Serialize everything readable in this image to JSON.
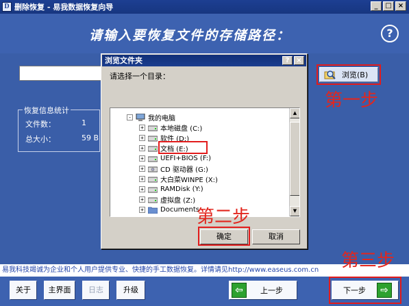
{
  "window": {
    "logo": "D",
    "title": "删除恢复 - 易我数据恢复向导",
    "controls": [
      "_",
      "□",
      "×"
    ]
  },
  "header": {
    "title": "请输入要恢复文件的存储路径：",
    "help": "?"
  },
  "path_input": {
    "value": ""
  },
  "browse_button": {
    "label": "浏览(B)"
  },
  "steps": {
    "step1": "第一步",
    "step2": "第二步",
    "step3": "第三步"
  },
  "stats": {
    "title": "恢复信息统计",
    "files_label": "文件数：",
    "files_value": "1",
    "size_label": "总大小：",
    "size_value": "59 B"
  },
  "dialog": {
    "title": "浏览文件夹",
    "controls": [
      "?",
      "×"
    ],
    "prompt": "请选择一个目录：",
    "tree": [
      {
        "label": "我的电脑",
        "expander": "-",
        "icon": "computer-icon"
      },
      {
        "label": "本地磁盘 (C:)",
        "expander": "+",
        "icon": "drive-icon"
      },
      {
        "label": "软件 (D:)",
        "expander": "+",
        "icon": "drive-icon"
      },
      {
        "label": "文档 (E:)",
        "expander": "+",
        "icon": "drive-icon"
      },
      {
        "label": "UEFI+BIOS (F:)",
        "expander": "+",
        "icon": "drive-icon"
      },
      {
        "label": "CD 驱动器 (G:)",
        "expander": "+",
        "icon": "cd-drive-icon"
      },
      {
        "label": "大白菜WINPE (X:)",
        "expander": "+",
        "icon": "drive-icon"
      },
      {
        "label": "RAMDisk (Y:)",
        "expander": "+",
        "icon": "drive-icon"
      },
      {
        "label": "虚拟盘 (Z:)",
        "expander": "+",
        "icon": "drive-icon"
      },
      {
        "label": "Documents",
        "expander": "+",
        "icon": "folder-icon"
      }
    ],
    "ok": "确定",
    "cancel": "取消"
  },
  "infobar": "易我科技竭诚为企业和个人用户提供专业、快捷的手工数据恢复。详情请见http://www.easeus.com.cn",
  "bottom": {
    "about": "关于",
    "main": "主界面",
    "log": "日志",
    "upgrade": "升级",
    "prev": "上一步",
    "next": "下一步"
  },
  "colors": {
    "background": "#3a5ea8",
    "highlight": "#e21b1b",
    "nav_arrow": "#2da12f"
  }
}
